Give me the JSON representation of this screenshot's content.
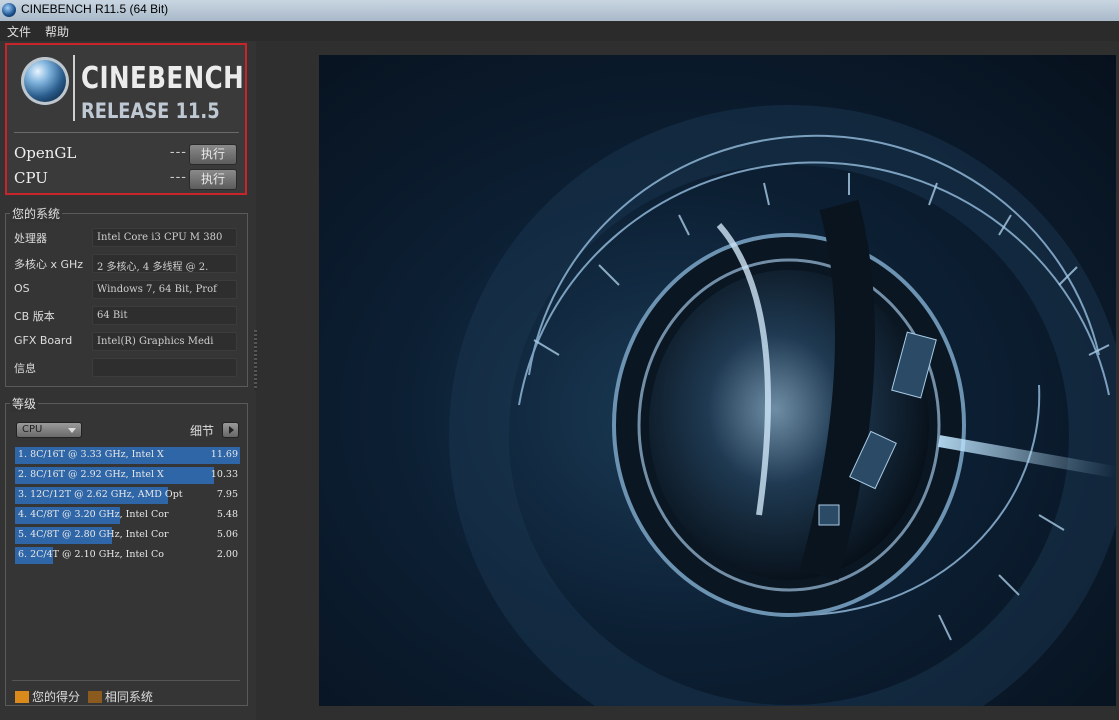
{
  "window": {
    "title": "CINEBENCH R11.5 (64 Bit)"
  },
  "menu": {
    "items": [
      "文件",
      "帮助"
    ]
  },
  "logo": {
    "name": "CINEBENCH",
    "release": "RELEASE 11.5"
  },
  "benchmarks": [
    {
      "label": "OpenGL",
      "score": "---",
      "button": "执行"
    },
    {
      "label": "CPU",
      "score": "---",
      "button": "执行"
    }
  ],
  "system": {
    "title": "您的系统",
    "rows": [
      {
        "key": "处理器",
        "value": "Intel Core i3 CPU M 380"
      },
      {
        "key": "多核心 x GHz",
        "value": "2 多核心, 4 多线程 @ 2."
      },
      {
        "key": "OS",
        "value": "Windows 7, 64 Bit, Prof"
      },
      {
        "key": "CB 版本",
        "value": "64 Bit"
      },
      {
        "key": "GFX Board",
        "value": "Intel(R) Graphics Medi"
      },
      {
        "key": "信息",
        "value": ""
      }
    ]
  },
  "ranking": {
    "title": "等级",
    "selector": "CPU",
    "detail_label": "细节",
    "max_score": 11.69,
    "rows": [
      {
        "text": "1. 8C/16T @ 3.33 GHz, Intel X",
        "score": "11.69",
        "value": 11.69
      },
      {
        "text": "2. 8C/16T @ 2.92 GHz, Intel X",
        "score": "10.33",
        "value": 10.33
      },
      {
        "text": "3. 12C/12T @ 2.62 GHz, AMD Opt",
        "score": "7.95",
        "value": 7.95
      },
      {
        "text": "4. 4C/8T @ 3.20 GHz, Intel Cor",
        "score": "5.48",
        "value": 5.48
      },
      {
        "text": "5. 4C/8T @ 2.80 GHz, Intel Cor",
        "score": "5.06",
        "value": 5.06
      },
      {
        "text": "6. 2C/4T @ 2.10 GHz, Intel Co",
        "score": "2.00",
        "value": 2.0
      }
    ]
  },
  "legend": {
    "your_score": "您的得分",
    "similar": "相同系统",
    "your_score_color": "#d98a1a",
    "similar_color": "#8a5a1e"
  },
  "colors": {
    "rank_bar": "#2f66a8",
    "highlight_border": "#c8242a"
  }
}
